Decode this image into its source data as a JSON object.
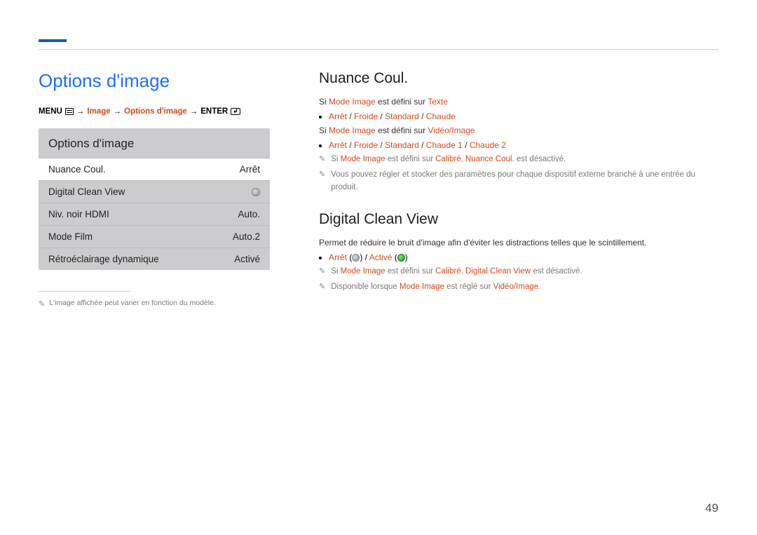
{
  "page_title": "Options d'image",
  "breadcrumb": {
    "menu": "MENU",
    "step1": "Image",
    "step2": "Options d'image",
    "enter": "ENTER"
  },
  "panel": {
    "title": "Options d'image",
    "rows": [
      {
        "label": "Nuance Coul.",
        "value": "Arrêt"
      },
      {
        "label": "Digital Clean View",
        "value_kind": "dot-grey"
      },
      {
        "label": "Niv. noir HDMI",
        "value": "Auto."
      },
      {
        "label": "Mode Film",
        "value": "Auto.2"
      },
      {
        "label": "Rétroéclairage dynamique",
        "value": "Activé"
      }
    ]
  },
  "footnote": "L'image affichée peut varier en fonction du modèle.",
  "nuance": {
    "heading": "Nuance Coul.",
    "line1_a": "Si ",
    "line1_b": "Mode Image",
    "line1_c": " est défini sur ",
    "line1_d": "Texte",
    "options1": [
      "Arrêt",
      "Froide",
      "Standard",
      "Chaude"
    ],
    "line2_a": "Si ",
    "line2_b": "Mode Image",
    "line2_c": " est défini sur ",
    "line2_d": "Vidéo/Image",
    "options2": [
      "Arrêt",
      "Froide",
      "Standard",
      "Chaude 1",
      "Chaude 2"
    ],
    "note1_a": "Si ",
    "note1_b": "Mode Image",
    "note1_c": " est défini sur ",
    "note1_d": "Calibré",
    "note1_e": ", ",
    "note1_f": "Nuance Coul.",
    "note1_g": " est désactivé.",
    "note2": "Vous pouvez régler et stocker des paramètres pour chaque dispositif externe branché à une entrée du produit."
  },
  "dcv": {
    "heading": "Digital Clean View",
    "desc": "Permet de réduire le bruit d'image afin d'éviter les distractions telles que le scintillement.",
    "opt_off": "Arrêt",
    "opt_on": "Activé",
    "note1_a": "Si ",
    "note1_b": "Mode Image",
    "note1_c": " est défini sur ",
    "note1_d": "Calibré",
    "note1_e": ", ",
    "note1_f": "Digital Clean View",
    "note1_g": " est désactivé.",
    "note2_a": "Disponible lorsque ",
    "note2_b": "Mode Image",
    "note2_c": " est réglé sur ",
    "note2_d": "Vidéo/Image",
    "note2_e": "."
  },
  "page_number": "49"
}
